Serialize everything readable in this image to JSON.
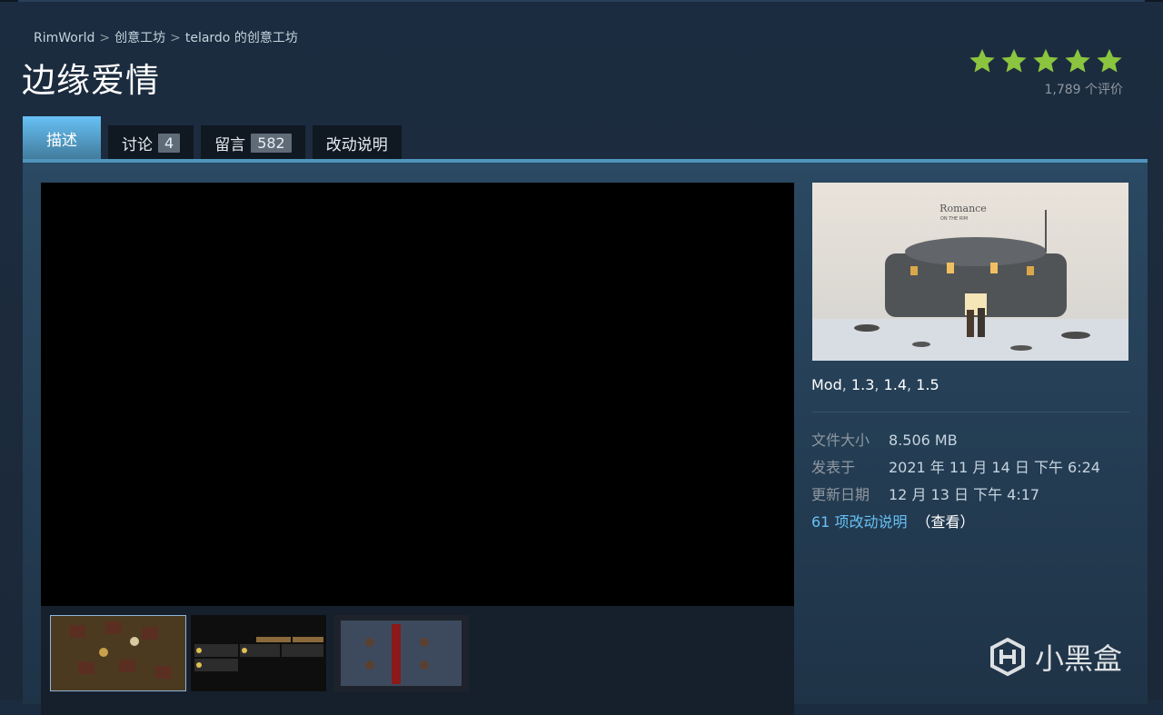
{
  "breadcrumb": {
    "game": "RimWorld",
    "workshop": "创意工坊",
    "author": "telardo 的创意工坊"
  },
  "title": "边缘爱情",
  "rating": {
    "stars": 5,
    "count_text": "1,789 个评价"
  },
  "tabs": [
    {
      "label": "描述"
    },
    {
      "label": "讨论",
      "count": "4"
    },
    {
      "label": "留言",
      "count": "582"
    },
    {
      "label": "改动说明"
    }
  ],
  "preview": {
    "title": "Romance",
    "subtitle": "ON THE RIM"
  },
  "tags": {
    "mod": "Mod",
    "v1": "1.3",
    "v2": "1.4",
    "v3": "1.5"
  },
  "details": {
    "size_label": "文件大小",
    "size_value": "8.506 MB",
    "posted_label": "发表于",
    "posted_value": "2021 年 11 月 14 日 下午 6:24",
    "updated_label": "更新日期",
    "updated_value": "12 月 13 日 下午 4:17"
  },
  "changes": {
    "link_text": "61 项改动说明",
    "view_text": "（查看）"
  },
  "watermark": {
    "text": "小黑盒"
  },
  "colors": {
    "accent": "#67c1f5",
    "star": "#8bc53f",
    "background": "#1b2838"
  }
}
